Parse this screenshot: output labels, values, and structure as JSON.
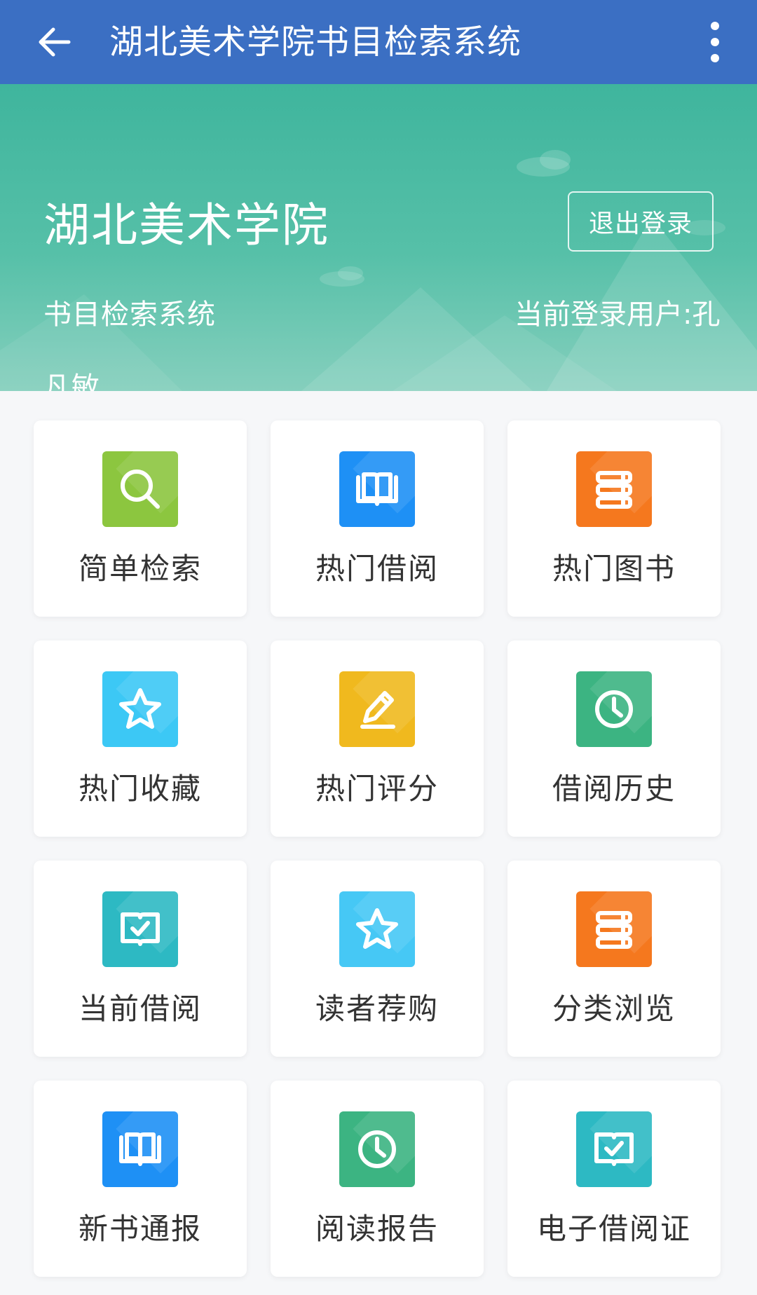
{
  "appbar": {
    "title": "湖北美术学院书目检索系统"
  },
  "banner": {
    "title": "湖北美术学院",
    "subtitle": "书目检索系统",
    "logout_label": "退出登录",
    "user_label": "当前登录用户:孔",
    "user_name_rest": "凡敏"
  },
  "tiles": [
    {
      "label": "简单检索",
      "icon": "search-icon",
      "color": "#8cc63f"
    },
    {
      "label": "热门借阅",
      "icon": "open-book-icon",
      "color": "#1e90f5"
    },
    {
      "label": "热门图书",
      "icon": "book-stack-icon",
      "color": "#f5781e"
    },
    {
      "label": "热门收藏",
      "icon": "star-icon",
      "color": "#3cc8f5"
    },
    {
      "label": "热门评分",
      "icon": "pencil-icon",
      "color": "#f0b91e"
    },
    {
      "label": "借阅历史",
      "icon": "clock-icon",
      "color": "#3cb482"
    },
    {
      "label": "当前借阅",
      "icon": "book-check-icon",
      "color": "#2db9c3"
    },
    {
      "label": "读者荐购",
      "icon": "star-icon",
      "color": "#46c8f5"
    },
    {
      "label": "分类浏览",
      "icon": "book-stack-icon",
      "color": "#f5781e"
    },
    {
      "label": "新书通报",
      "icon": "open-book-icon",
      "color": "#1e90f5"
    },
    {
      "label": "阅读报告",
      "icon": "clock-icon",
      "color": "#3cb482"
    },
    {
      "label": "电子借阅证",
      "icon": "book-check-icon",
      "color": "#2db9c3"
    }
  ]
}
